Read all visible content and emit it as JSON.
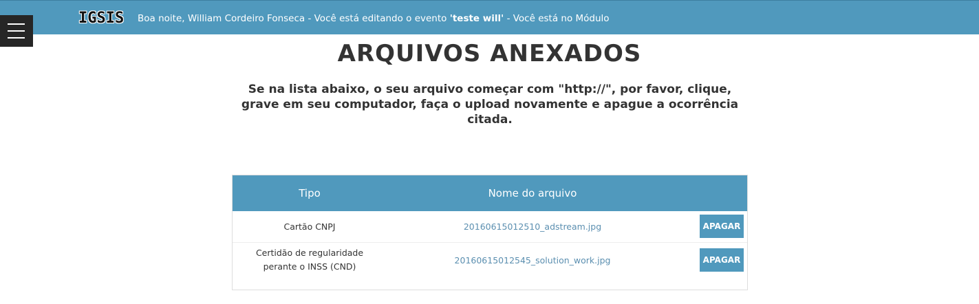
{
  "header": {
    "brand": "IGSIS",
    "greeting_prefix": "Boa noite, William Cordeiro Fonseca - Você está editando o evento ",
    "event_name": "'teste will'",
    "greeting_suffix": " - Você está no Módulo",
    "bar_color": "#5099bd"
  },
  "menu": {
    "icon": "hamburger-icon"
  },
  "page": {
    "title": "ARQUIVOS ANEXADOS",
    "notice": "Se na lista abaixo, o seu arquivo começar com \"http://\", por favor, clique, grave em seu computador, faça o upload novamente e apague a ocorrência citada."
  },
  "table": {
    "columns": [
      "Tipo",
      "Nome do arquivo",
      ""
    ],
    "rows": [
      {
        "tipo": "Cartão CNPJ",
        "arquivo": "20160615012510_adstream.jpg",
        "action": "APAGAR"
      },
      {
        "tipo": "Certidão de regularidade perante o INSS (CND)",
        "arquivo": "20160615012545_solution_work.jpg",
        "action": "APAGAR"
      }
    ]
  }
}
